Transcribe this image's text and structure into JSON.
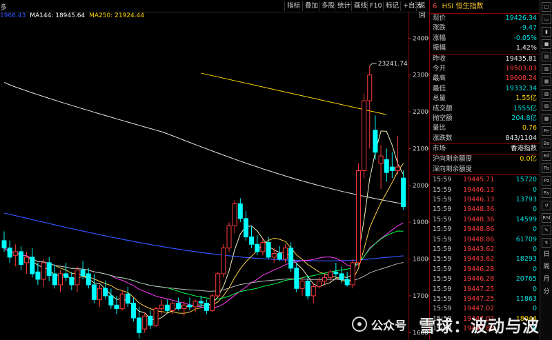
{
  "toolbar": {
    "left_label": "多",
    "buttons": [
      "指标",
      "叠加",
      "多股",
      "统计",
      "画线",
      "F10",
      "标记",
      "+自选",
      "返回"
    ]
  },
  "legend": [
    {
      "label": "MA144: 18945.64",
      "color": "#ffffff"
    },
    {
      "label": "MA250: 21924.44",
      "color": "#ffd700"
    }
  ],
  "legend_prefix": {
    "label": "1968.43",
    "color": "#3355ff"
  },
  "quote": {
    "index_no": "6",
    "title": "HSI 恒生指数",
    "rows_a": [
      {
        "k": "现价",
        "v": "19426.34",
        "c": "g"
      },
      {
        "k": "涨跌",
        "v": "-9.47",
        "c": "g"
      },
      {
        "k": "涨幅",
        "v": "-0.05%",
        "c": "g"
      },
      {
        "k": "振幅",
        "v": "1.42%",
        "c": "w"
      }
    ],
    "rows_b": [
      {
        "k": "昨收",
        "v": "19435.81",
        "c": "w"
      },
      {
        "k": "今开",
        "v": "19503.03",
        "c": "r"
      },
      {
        "k": "最高",
        "v": "19608.24",
        "c": "r"
      },
      {
        "k": "最低",
        "v": "19332.34",
        "c": "g"
      },
      {
        "k": "总量",
        "v": "1.55亿",
        "c": "y"
      },
      {
        "k": "成交额",
        "v": "1555亿",
        "c": "g"
      },
      {
        "k": "抛空额",
        "v": "204.8亿",
        "c": "g"
      },
      {
        "k": "量比",
        "v": "0.76",
        "c": "y"
      },
      {
        "k": "涨跌数",
        "v": "843/1104",
        "c": "w"
      }
    ],
    "market_row": {
      "k": "市场",
      "v": "香港指数"
    },
    "quota_rows": [
      {
        "k": "沪向剩余额度",
        "v": "0.0亿"
      },
      {
        "k": "深向剩余额度",
        "v": ""
      }
    ],
    "ticks": [
      {
        "t": "15:59",
        "p": "19445.71",
        "v": "15720",
        "c": "g"
      },
      {
        "t": "15:59",
        "p": "19446.13",
        "v": "0",
        "c": "g"
      },
      {
        "t": "15:59",
        "p": "19446.13",
        "v": "13793",
        "c": "g"
      },
      {
        "t": "15:59",
        "p": "19448.36",
        "v": "0",
        "c": "g"
      },
      {
        "t": "15:59",
        "p": "19448.36",
        "v": "14599",
        "c": "g"
      },
      {
        "t": "15:59",
        "p": "19448.86",
        "v": "0",
        "c": "g"
      },
      {
        "t": "15:59",
        "p": "19448.86",
        "v": "61709",
        "c": "g"
      },
      {
        "t": "15:59",
        "p": "19443.62",
        "v": "0",
        "c": "g"
      },
      {
        "t": "15:59",
        "p": "19443.62",
        "v": "18293",
        "c": "g"
      },
      {
        "t": "15:59",
        "p": "19446.28",
        "v": "0",
        "c": "g"
      },
      {
        "t": "15:59",
        "p": "19446.28",
        "v": "20765",
        "c": "g"
      },
      {
        "t": "15:59",
        "p": "19447.25",
        "v": "0",
        "c": "g"
      },
      {
        "t": "15:59",
        "p": "19447.25",
        "v": "11863",
        "c": "g"
      },
      {
        "t": "15:59",
        "p": "19447.02",
        "v": "0",
        "c": "g"
      },
      {
        "t": "15:59",
        "p": "19447.02",
        "v": "18044",
        "c": "y"
      },
      {
        "t": "15:59",
        "p": "19447.86",
        "v": "0",
        "c": "g"
      }
    ]
  },
  "side_icons": [
    "□",
    "▭",
    "▮",
    "■",
    "▤",
    "▥",
    "▦",
    "▧",
    "▨",
    "▩",
    "Fe",
    "Bo",
    "Ed",
    "Fb",
    "Pz",
    "Rs",
    "↺",
    "RSI",
    "✎",
    "↯"
  ],
  "side_text": [
    "日",
    "周",
    "月",
    "分"
  ],
  "price_axis": {
    "ticks": [
      24000,
      23000,
      22000,
      21000,
      20000,
      19000,
      18000,
      17000,
      16000
    ],
    "min": 15800,
    "max": 24700
  },
  "annotations": {
    "high_label": "23241.74"
  },
  "watermark": {
    "text1": "公众号",
    "text2": "雪球：波动与波"
  },
  "chart_data": {
    "type": "candlestick",
    "y_axis_ticks": [
      16000,
      17000,
      18000,
      19000,
      20000,
      21000,
      22000,
      23000,
      24000
    ],
    "ylim": [
      15800,
      24700
    ],
    "candles": [
      {
        "o": 18500,
        "h": 18750,
        "l": 18200,
        "c": 18300
      },
      {
        "o": 18300,
        "h": 18500,
        "l": 17900,
        "c": 18050
      },
      {
        "o": 18100,
        "h": 18400,
        "l": 17800,
        "c": 18200
      },
      {
        "o": 18200,
        "h": 18350,
        "l": 17700,
        "c": 17850
      },
      {
        "o": 17900,
        "h": 18200,
        "l": 17600,
        "c": 18050
      },
      {
        "o": 18050,
        "h": 18300,
        "l": 17500,
        "c": 17600
      },
      {
        "o": 17650,
        "h": 17900,
        "l": 17300,
        "c": 17450
      },
      {
        "o": 17450,
        "h": 18000,
        "l": 17250,
        "c": 17900
      },
      {
        "o": 17900,
        "h": 18050,
        "l": 17400,
        "c": 17550
      },
      {
        "o": 17600,
        "h": 17850,
        "l": 17200,
        "c": 17300
      },
      {
        "o": 17300,
        "h": 17700,
        "l": 17100,
        "c": 17600
      },
      {
        "o": 17600,
        "h": 17900,
        "l": 17400,
        "c": 17500
      },
      {
        "o": 17500,
        "h": 17650,
        "l": 17150,
        "c": 17300
      },
      {
        "o": 17300,
        "h": 17800,
        "l": 17100,
        "c": 17700
      },
      {
        "o": 17700,
        "h": 17950,
        "l": 17450,
        "c": 17550
      },
      {
        "o": 17600,
        "h": 17750,
        "l": 17200,
        "c": 17300
      },
      {
        "o": 17300,
        "h": 17600,
        "l": 16800,
        "c": 16900
      },
      {
        "o": 16900,
        "h": 17300,
        "l": 16700,
        "c": 17200
      },
      {
        "o": 17200,
        "h": 17400,
        "l": 16900,
        "c": 17000
      },
      {
        "o": 17000,
        "h": 17200,
        "l": 16650,
        "c": 16750
      },
      {
        "o": 16750,
        "h": 17000,
        "l": 16500,
        "c": 16650
      },
      {
        "o": 16650,
        "h": 17150,
        "l": 16600,
        "c": 17050
      },
      {
        "o": 17050,
        "h": 17250,
        "l": 16700,
        "c": 16800
      },
      {
        "o": 16800,
        "h": 16950,
        "l": 16300,
        "c": 16400
      },
      {
        "o": 16400,
        "h": 16700,
        "l": 15850,
        "c": 16000
      },
      {
        "o": 16100,
        "h": 16550,
        "l": 16000,
        "c": 16450
      },
      {
        "o": 16450,
        "h": 16600,
        "l": 16100,
        "c": 16200
      },
      {
        "o": 16200,
        "h": 16700,
        "l": 16150,
        "c": 16650
      },
      {
        "o": 16650,
        "h": 16900,
        "l": 16500,
        "c": 16750
      },
      {
        "o": 16750,
        "h": 16900,
        "l": 16550,
        "c": 16600
      },
      {
        "o": 16600,
        "h": 16850,
        "l": 16500,
        "c": 16800
      },
      {
        "o": 16800,
        "h": 16950,
        "l": 16600,
        "c": 16650
      },
      {
        "o": 16650,
        "h": 16850,
        "l": 16450,
        "c": 16750
      },
      {
        "o": 16750,
        "h": 16950,
        "l": 16600,
        "c": 16700
      },
      {
        "o": 16700,
        "h": 16900,
        "l": 16550,
        "c": 16850
      },
      {
        "o": 16850,
        "h": 17000,
        "l": 16700,
        "c": 16800
      },
      {
        "o": 16800,
        "h": 16900,
        "l": 16500,
        "c": 16600
      },
      {
        "o": 16600,
        "h": 17050,
        "l": 16550,
        "c": 17000
      },
      {
        "o": 17000,
        "h": 17650,
        "l": 16950,
        "c": 17600
      },
      {
        "o": 17600,
        "h": 18400,
        "l": 17500,
        "c": 18300
      },
      {
        "o": 18300,
        "h": 19000,
        "l": 18200,
        "c": 18900
      },
      {
        "o": 18900,
        "h": 19600,
        "l": 18700,
        "c": 19500
      },
      {
        "o": 19500,
        "h": 19650,
        "l": 19000,
        "c": 19100
      },
      {
        "o": 19100,
        "h": 19300,
        "l": 18500,
        "c": 18600
      },
      {
        "o": 18600,
        "h": 18900,
        "l": 18300,
        "c": 18400
      },
      {
        "o": 18400,
        "h": 18650,
        "l": 18100,
        "c": 18200
      },
      {
        "o": 18200,
        "h": 18550,
        "l": 18100,
        "c": 18450
      },
      {
        "o": 18450,
        "h": 18600,
        "l": 18000,
        "c": 18050
      },
      {
        "o": 18050,
        "h": 18300,
        "l": 17900,
        "c": 18150
      },
      {
        "o": 18150,
        "h": 18350,
        "l": 17950,
        "c": 18000
      },
      {
        "o": 18000,
        "h": 18400,
        "l": 17900,
        "c": 18300
      },
      {
        "o": 18300,
        "h": 18450,
        "l": 17650,
        "c": 17750
      },
      {
        "o": 17750,
        "h": 17900,
        "l": 17100,
        "c": 17200
      },
      {
        "o": 17200,
        "h": 17500,
        "l": 17000,
        "c": 17400
      },
      {
        "o": 17400,
        "h": 17550,
        "l": 16900,
        "c": 17000
      },
      {
        "o": 17000,
        "h": 17350,
        "l": 16800,
        "c": 17250
      },
      {
        "o": 17250,
        "h": 17500,
        "l": 17200,
        "c": 17400
      },
      {
        "o": 17400,
        "h": 17600,
        "l": 17300,
        "c": 17500
      },
      {
        "o": 17500,
        "h": 17700,
        "l": 17400,
        "c": 17650
      },
      {
        "o": 17650,
        "h": 17900,
        "l": 17500,
        "c": 17600
      },
      {
        "o": 17600,
        "h": 17800,
        "l": 17350,
        "c": 17450
      },
      {
        "o": 17450,
        "h": 17650,
        "l": 17250,
        "c": 17300
      },
      {
        "o": 17300,
        "h": 18000,
        "l": 17200,
        "c": 17900
      },
      {
        "o": 17900,
        "h": 20600,
        "l": 17800,
        "c": 20400
      },
      {
        "o": 20400,
        "h": 22500,
        "l": 20200,
        "c": 22300
      },
      {
        "o": 22300,
        "h": 23241.74,
        "l": 21000,
        "c": 23000
      },
      {
        "o": 21500,
        "h": 21900,
        "l": 20700,
        "c": 20900
      },
      {
        "o": 20600,
        "h": 21100,
        "l": 19900,
        "c": 20800
      },
      {
        "o": 20700,
        "h": 21000,
        "l": 20100,
        "c": 20350
      },
      {
        "o": 20500,
        "h": 20900,
        "l": 20200,
        "c": 20400
      },
      {
        "o": 20400,
        "h": 21350,
        "l": 20300,
        "c": 20500
      },
      {
        "o": 20200,
        "h": 20400,
        "l": 19332,
        "c": 19426
      }
    ],
    "series": [
      {
        "name": "MA144",
        "values_start": 22800,
        "values_end": 18900
      },
      {
        "name": "MA250",
        "values_start": 23100,
        "values_end": 21924.44
      }
    ]
  }
}
